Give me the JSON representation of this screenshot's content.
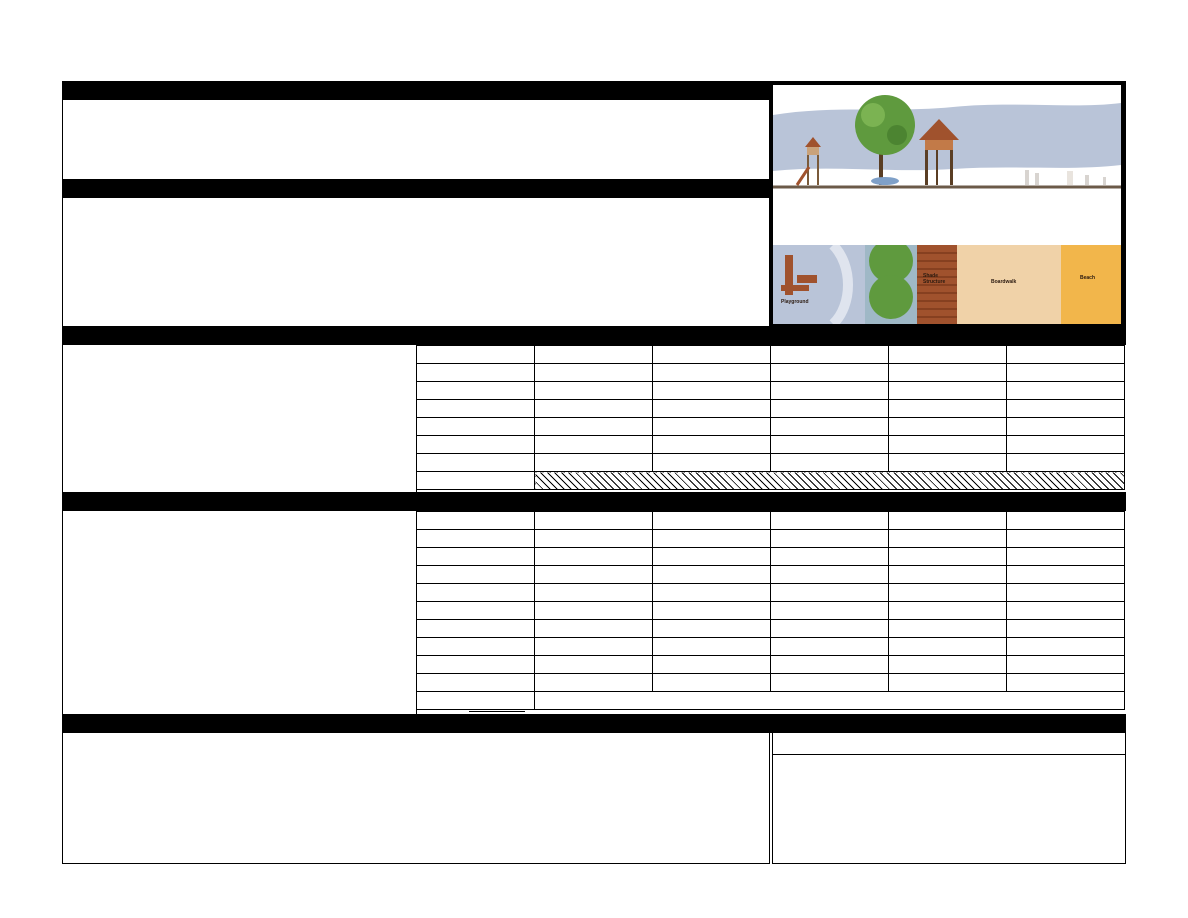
{
  "document": {
    "sections": [
      {
        "id": "section-1",
        "label": ""
      },
      {
        "id": "section-2",
        "label": ""
      },
      {
        "id": "section-3",
        "label": ""
      },
      {
        "id": "section-4",
        "label": ""
      },
      {
        "id": "section-5",
        "label": ""
      }
    ],
    "illustration": {
      "plan_labels": {
        "playground": "Playground",
        "shade_structure": "Shade\nStructure",
        "boardwalk": "Boardwalk",
        "beach": "Beach"
      }
    },
    "table_1": {
      "rows": 8,
      "cols": 6
    },
    "table_2": {
      "rows": 11,
      "cols": 6
    }
  },
  "colors": {
    "bar": "#000000",
    "sky": "#b9c4d8",
    "tree": "#5f9a3e",
    "wood": "#a0522d",
    "sand": "#f0d2a8",
    "beach": "#f2b64b"
  }
}
